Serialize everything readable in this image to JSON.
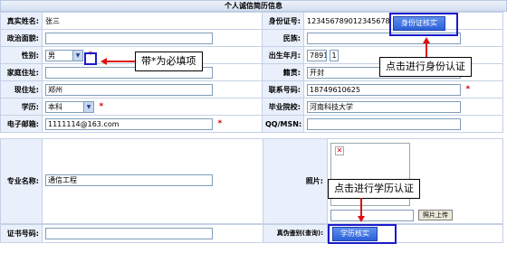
{
  "title": "个人诚信简历信息",
  "fields": {
    "name_label": "真实姓名:",
    "name_value": "张三",
    "political_label": "政治面貌:",
    "gender_label": "性别:",
    "gender_value": "男",
    "home_label": "家庭住址:",
    "residence_label": "现住址:",
    "residence_value": "郑州",
    "education_label": "学历:",
    "education_value": "本科",
    "email_label": "电子邮箱:",
    "email_value": "1111114@163.com",
    "major_label": "专业名称:",
    "major_value": "通信工程",
    "cert_label": "证书号码:",
    "id_label": "身份证号:",
    "id_value": "123456789012345678",
    "ethnicity_label": "民族:",
    "birth_label": "出生年月:",
    "birth_year": "7891",
    "birth_month": "1",
    "native_label": "籍贯:",
    "native_value": "开封",
    "phone_label": "联系号码:",
    "phone_value": "18749610625",
    "school_label": "毕业院校:",
    "school_value": "河南科技大学",
    "qq_label": "QQ/MSN:",
    "photo_label": "照片:",
    "verify_label": "真伪鉴别(查询):"
  },
  "required_mark": "*",
  "buttons": {
    "id_verify": "身份证核实",
    "edu_verify": "学历核实",
    "photo_upload": "照片上传"
  },
  "callouts": {
    "required_note": "带*为必填项",
    "id_note": "点击进行身份认证",
    "edu_note": "点击进行学历认证"
  },
  "colors": {
    "header_bg": "#d3def0",
    "label_bg": "#eaf0fb",
    "button_blue": "#2c60d8",
    "required_red": "#d00000",
    "arrow_red": "#e01010",
    "highlight_blue": "#1a1acc"
  },
  "icons": {
    "dropdown": "chevron-down-icon",
    "broken_image": "broken-image-icon"
  }
}
